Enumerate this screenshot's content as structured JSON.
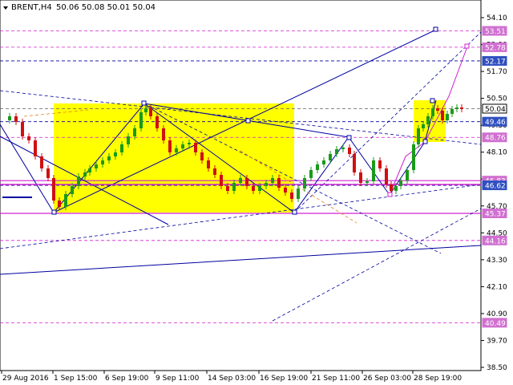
{
  "header": {
    "symbol_timeframe": "BRENT,H4",
    "ohlc": "50.06 50.08 50.01 50.04"
  },
  "price_axis": {
    "ticks": [
      "54.10",
      "52.90",
      "51.70",
      "50.50",
      "49.30",
      "48.10",
      "46.90",
      "45.70",
      "44.50",
      "43.30",
      "42.10",
      "40.90",
      "39.70",
      "38.50"
    ]
  },
  "time_axis": {
    "labels": [
      "29 Aug 2016",
      "1 Sep 15:00",
      "6 Sep 19:00",
      "9 Sep 11:00",
      "14 Sep 03:00",
      "16 Sep 19:00",
      "21 Sep 11:00",
      "26 Sep 03:00",
      "28 Sep 19:00"
    ]
  },
  "level_tags": [
    {
      "label": "53.51",
      "price": 53.51,
      "color": "#d070d0"
    },
    {
      "label": "52.78",
      "price": 52.78,
      "color": "#d070d0"
    },
    {
      "label": "52.17",
      "price": 52.17,
      "color": "#3050c0"
    },
    {
      "label": "50.04",
      "price": 50.04,
      "color": "#ffffff"
    },
    {
      "label": "49.46",
      "price": 49.46,
      "color": "#3050c0"
    },
    {
      "label": "48.76",
      "price": 48.76,
      "color": "#d070d0"
    },
    {
      "label": "46.83",
      "price": 46.83,
      "color": "#d070d0"
    },
    {
      "label": "46.62",
      "price": 46.62,
      "color": "#3050c0"
    },
    {
      "label": "45.37",
      "price": 45.37,
      "color": "#d070d0"
    },
    {
      "label": "44.16",
      "price": 44.16,
      "color": "#d070d0"
    },
    {
      "label": "40.49",
      "price": 40.49,
      "color": "#d070d0"
    }
  ],
  "colors": {
    "bull": "#1a9a1a",
    "bear": "#d01010",
    "zone": "#ffff00",
    "blue_line": "#0000a0",
    "magenta_line": "#d020d0"
  }
}
